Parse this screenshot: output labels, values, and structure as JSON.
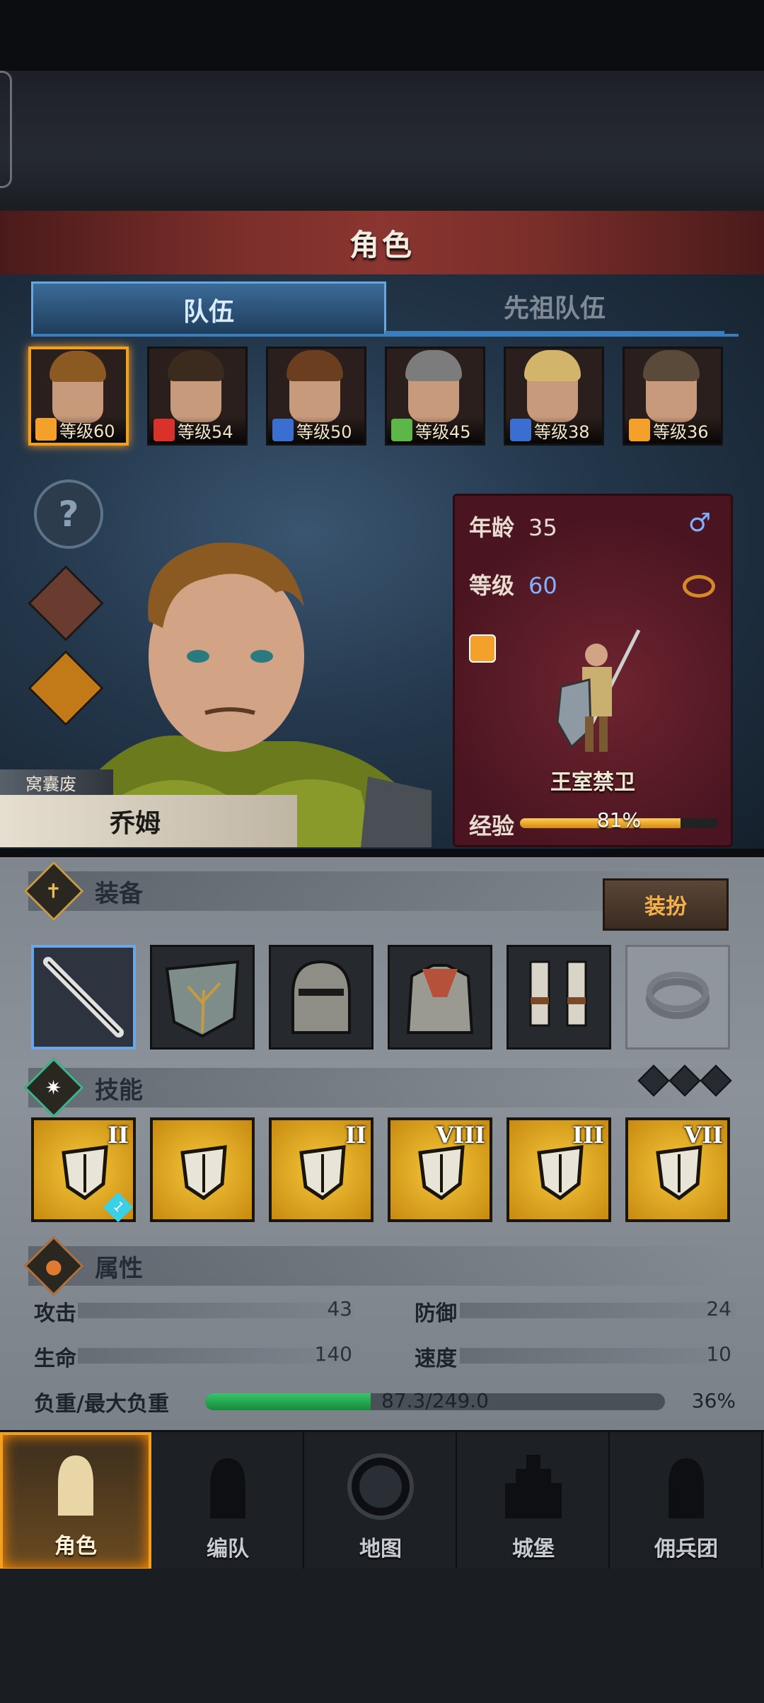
{
  "screen": {
    "title": "角色",
    "tabs": [
      {
        "label": "队伍"
      },
      {
        "label": "先祖队伍"
      }
    ]
  },
  "team": [
    {
      "level": "等级60",
      "class_color": "#f3a12a",
      "hair": "#8a5a22",
      "selected": true
    },
    {
      "level": "等级54",
      "class_color": "#d8322b",
      "hair": "#3b2a1e"
    },
    {
      "level": "等级50",
      "class_color": "#3a6ed0",
      "hair": "#6a3e1e"
    },
    {
      "level": "等级45",
      "class_color": "#5db648",
      "hair": "#7c7c7c"
    },
    {
      "level": "等级38",
      "class_color": "#3a6ed0",
      "hair": "#d2b46a"
    },
    {
      "level": "等级36",
      "class_color": "#f3a12a",
      "hair": "#5a4a3a"
    }
  ],
  "hero": {
    "nickname": "窝囊废",
    "name": "乔姆",
    "age_label": "年龄",
    "age": "35",
    "level_label": "等级",
    "level": "60",
    "class_name": "王室禁卫",
    "exp_label": "经验",
    "exp_percent": 81,
    "exp_text": "81%"
  },
  "equipment": {
    "title": "装备",
    "dress_button": "装扮",
    "items": [
      "sword-icon",
      "shield-icon",
      "helmet-icon",
      "armor-icon",
      "boots-icon",
      "ring-icon"
    ]
  },
  "skills": {
    "title": "技能",
    "items": [
      {
        "rank": "II",
        "badge": "1"
      },
      {
        "rank": ""
      },
      {
        "rank": "II"
      },
      {
        "rank": "VIII"
      },
      {
        "rank": "III"
      },
      {
        "rank": "VII"
      }
    ]
  },
  "attributes": {
    "title": "属性",
    "attack_label": "攻击",
    "attack": "43",
    "defense_label": "防御",
    "defense": "24",
    "hp_label": "生命",
    "hp": "140",
    "speed_label": "速度",
    "speed": "10",
    "load_label": "负重/最大负重",
    "load_text": "87.3/249.0",
    "load_percent": 36,
    "load_pct_text": "36%"
  },
  "nav": [
    {
      "label": "角色",
      "icon": "knight-icon"
    },
    {
      "label": "编队",
      "icon": "helmet-icon"
    },
    {
      "label": "地图",
      "icon": "compass-icon"
    },
    {
      "label": "城堡",
      "icon": "castle-icon"
    },
    {
      "label": "佣兵团",
      "icon": "banner-icon"
    }
  ],
  "colors": {
    "accent": "#f3a020",
    "tab_active": "#3b6b98",
    "panel_red": "#6e2430"
  }
}
